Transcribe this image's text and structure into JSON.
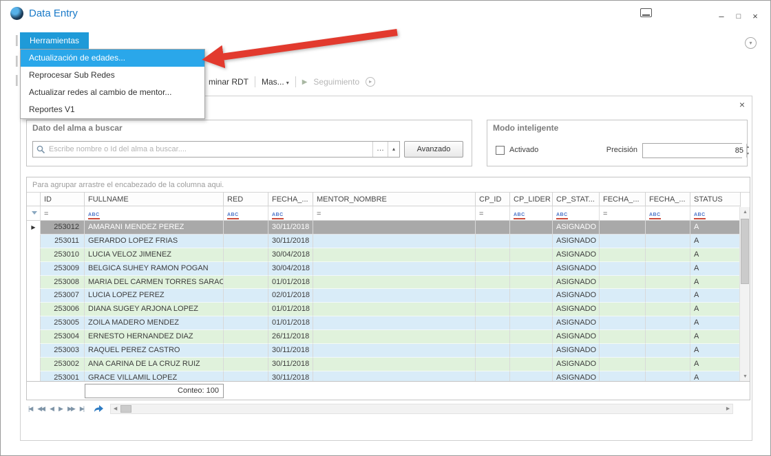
{
  "window": {
    "title": "Data Entry"
  },
  "icons": {
    "minimize": "–",
    "maximize": "□",
    "close": "×",
    "dropdown_caret": "▾",
    "ellipsis": "…",
    "spin_up": "▴",
    "spin_down": "▾",
    "scroll_up": "▲",
    "scroll_down": "▼",
    "scroll_left": "◀",
    "scroll_right": "▶",
    "play": "▶",
    "row_indicator": "▶",
    "collapse_circle": "▾",
    "refresh_circle": "▸"
  },
  "menubar": {
    "tools_label": "Herramientas"
  },
  "tools_menu": {
    "items": [
      {
        "label": "Actualización de edades...",
        "highlighted": true
      },
      {
        "label": "Reprocesar Sub Redes",
        "highlighted": false
      },
      {
        "label": "Actualizar redes al cambio de mentor...",
        "highlighted": false
      },
      {
        "label": "Reportes V1",
        "highlighted": false
      }
    ]
  },
  "toolbar": {
    "partial_item": "minar  RDT",
    "mas_item": "Mas...",
    "seguimiento_item": "Seguimiento"
  },
  "search_box": {
    "title": "Dato del alma a buscar",
    "placeholder": "Escribe nombre o Id del alma a buscar....",
    "value": "",
    "advanced_button": "Avanzado"
  },
  "smart_mode": {
    "title": "Modo inteligente",
    "activado_label": "Activado",
    "checkbox_checked": false,
    "precision_label": "Precisión",
    "precision_value": "85"
  },
  "grid": {
    "group_hint": "Para agrupar arrastre el encabezado de la columna aqui.",
    "columns": [
      "ID",
      "FULLNAME",
      "RED",
      "FECHA_...",
      "MENTOR_NOMBRE",
      "CP_ID",
      "CP_LIDER",
      "CP_STAT...",
      "FECHA_...",
      "FECHA_...",
      "STATUS"
    ],
    "filter_row": [
      "=",
      "abc",
      "abc",
      "abc",
      "=",
      "=",
      "abc",
      "abc",
      "=",
      "abc",
      "abc"
    ],
    "selected_row_index": 0,
    "rows": [
      [
        "253012",
        "AMARANI MENDEZ PEREZ",
        "",
        "30/11/2018",
        "",
        "",
        "",
        "ASIGNADO",
        "",
        "",
        "A"
      ],
      [
        "253011",
        "GERARDO LOPEZ FRIAS",
        "",
        "30/11/2018",
        "",
        "",
        "",
        "ASIGNADO",
        "",
        "",
        "A"
      ],
      [
        "253010",
        "LUCIA VELOZ JIMENEZ",
        "",
        "30/04/2018",
        "",
        "",
        "",
        "ASIGNADO",
        "",
        "",
        "A"
      ],
      [
        "253009",
        "BELGICA SUHEY RAMON POGAN",
        "",
        "30/04/2018",
        "",
        "",
        "",
        "ASIGNADO",
        "",
        "",
        "A"
      ],
      [
        "253008",
        "MARIA DEL CARMEN TORRES SARAO",
        "",
        "01/01/2018",
        "",
        "",
        "",
        "ASIGNADO",
        "",
        "",
        "A"
      ],
      [
        "253007",
        "LUCIA LOPEZ PEREZ",
        "",
        "02/01/2018",
        "",
        "",
        "",
        "ASIGNADO",
        "",
        "",
        "A"
      ],
      [
        "253006",
        "DIANA SUGEY ARJONA LOPEZ",
        "",
        "01/01/2018",
        "",
        "",
        "",
        "ASIGNADO",
        "",
        "",
        "A"
      ],
      [
        "253005",
        "ZOILA MADERO MENDEZ",
        "",
        "01/01/2018",
        "",
        "",
        "",
        "ASIGNADO",
        "",
        "",
        "A"
      ],
      [
        "253004",
        "ERNESTO HERNANDEZ DIAZ",
        "",
        "26/11/2018",
        "",
        "",
        "",
        "ASIGNADO",
        "",
        "",
        "A"
      ],
      [
        "253003",
        "RAQUEL PEREZ CASTRO",
        "",
        "30/11/2018",
        "",
        "",
        "",
        "ASIGNADO",
        "",
        "",
        "A"
      ],
      [
        "253002",
        "ANA CARINA DE LA CRUZ RUIZ",
        "",
        "30/11/2018",
        "",
        "",
        "",
        "ASIGNADO",
        "",
        "",
        "A"
      ],
      [
        "253001",
        "GRACE VILLAMIL LOPEZ",
        "",
        "30/11/2018",
        "",
        "",
        "",
        "ASIGNADO",
        "",
        "",
        "A"
      ]
    ],
    "footer": {
      "conteo_label": "Conteo:",
      "conteo_value": "100"
    }
  },
  "navigator": {
    "buttons": [
      "|◀",
      "◀◀",
      "◀",
      "▶",
      "▶▶",
      "▶|"
    ]
  },
  "colors": {
    "accent_blue": "#1e9ad8",
    "menu_highlight": "#2aa7ea",
    "title_blue": "#1879c8",
    "row_blue": "#d9ecf8",
    "row_green": "#e0f2dc",
    "selected_row_gray": "#a9a9a9",
    "annotation_arrow_red": "#e23a2e"
  }
}
